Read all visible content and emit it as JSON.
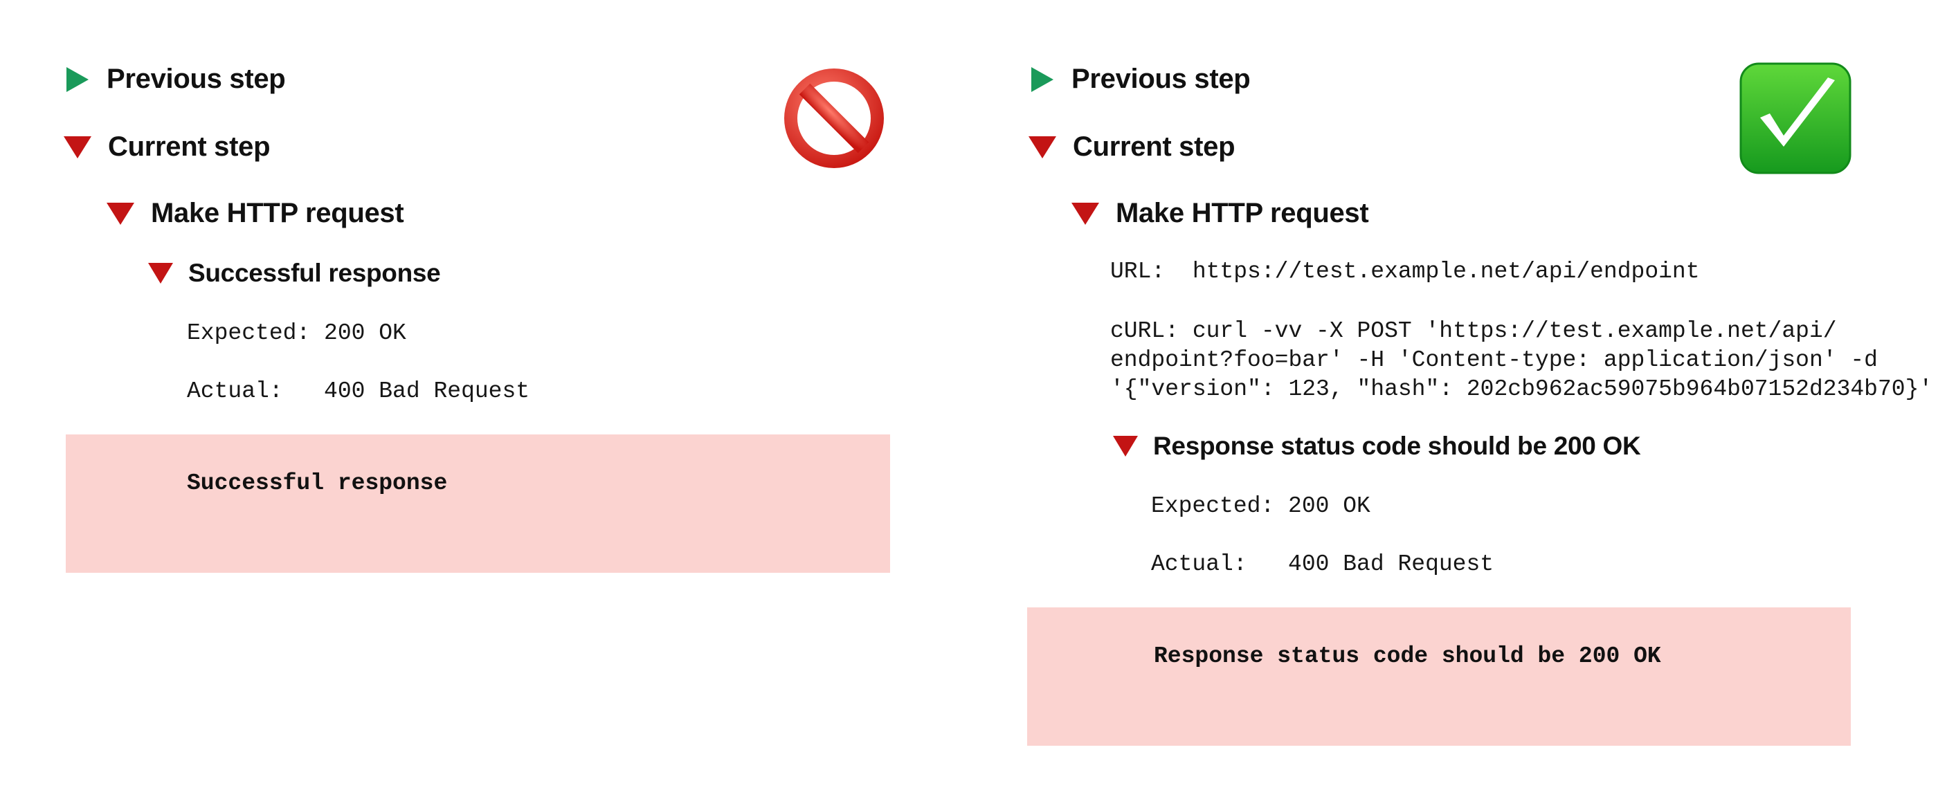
{
  "left": {
    "previous_step": "Previous step",
    "current_step": "Current step",
    "http_request": "Make HTTP request",
    "check_title": "Successful response",
    "expected": "Expected: 200 OK",
    "actual": "Actual:   400 Bad Request",
    "error_message": "Successful response",
    "badge_icon": "prohibited-icon"
  },
  "right": {
    "previous_step": "Previous step",
    "current_step": "Current step",
    "http_request": "Make HTTP request",
    "url_line": "URL:  https://test.example.net/api/endpoint",
    "curl_line1": "cURL: curl -vv -X POST 'https://test.example.net/api/",
    "curl_line2": "endpoint?foo=bar' -H 'Content-type: application/json' -d",
    "curl_line3": "'{\"version\": 123, \"hash\": 202cb962ac59075b964b07152d234b70}'",
    "check_title": "Response status code should be 200 OK",
    "expected": "Expected: 200 OK",
    "actual": "Actual:   400 Bad Request",
    "error_message": "Response status code should be 200 OK",
    "badge_icon": "check-mark-icon"
  },
  "colors": {
    "collapsed_triangle": "#1a9a5a",
    "expanded_triangle": "#c31414",
    "error_background": "#fbd3d0",
    "check_badge": "#22b02a",
    "prohibited_badge": "#e0302a"
  }
}
